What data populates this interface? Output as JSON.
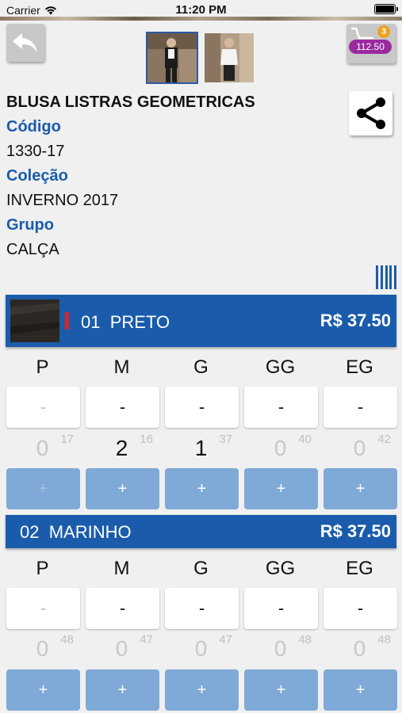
{
  "status_bar": {
    "carrier": "Carrier",
    "time": "11:20 PM"
  },
  "cart": {
    "count": "3",
    "total": "112.50"
  },
  "product": {
    "title": "BLUSA LISTRAS GEOMETRICAS",
    "code_label": "Código",
    "code": "1330-17",
    "collection_label": "Coleção",
    "collection": "INVERNO 2017",
    "group_label": "Grupo",
    "group": "CALÇA"
  },
  "icons": {
    "back": "back-arrow-icon",
    "cart": "shopping-cart-icon",
    "share": "share-icon",
    "barcode": "barcode-icon",
    "wifi": "wifi-icon",
    "battery": "battery-icon"
  },
  "colors": [
    {
      "code": "01",
      "name": "PRETO",
      "price": "R$ 37.50",
      "sizes": [
        {
          "size": "P",
          "minus": "-",
          "qty": "0",
          "stock": "17",
          "plus": "+"
        },
        {
          "size": "M",
          "minus": "-",
          "qty": "2",
          "stock": "16",
          "plus": "+"
        },
        {
          "size": "G",
          "minus": "-",
          "qty": "1",
          "stock": "37",
          "plus": "+"
        },
        {
          "size": "GG",
          "minus": "-",
          "qty": "0",
          "stock": "40",
          "plus": "+"
        },
        {
          "size": "EG",
          "minus": "-",
          "qty": "0",
          "stock": "42",
          "plus": "+"
        }
      ]
    },
    {
      "code": "02",
      "name": "MARINHO",
      "price": "R$ 37.50",
      "sizes": [
        {
          "size": "P",
          "minus": "-",
          "qty": "0",
          "stock": "48",
          "plus": "+"
        },
        {
          "size": "M",
          "minus": "-",
          "qty": "0",
          "stock": "47",
          "plus": "+"
        },
        {
          "size": "G",
          "minus": "-",
          "qty": "0",
          "stock": "47",
          "plus": "+"
        },
        {
          "size": "GG",
          "minus": "-",
          "qty": "0",
          "stock": "48",
          "plus": "+"
        },
        {
          "size": "EG",
          "minus": "-",
          "qty": "0",
          "stock": "48",
          "plus": "+"
        }
      ]
    }
  ],
  "theme": {
    "accent": "#1a5cab",
    "plus_button": "#7fa9d6",
    "badge_orange": "#f0a020",
    "badge_purple": "#9b2aa0",
    "marker_red": "#e02020"
  }
}
